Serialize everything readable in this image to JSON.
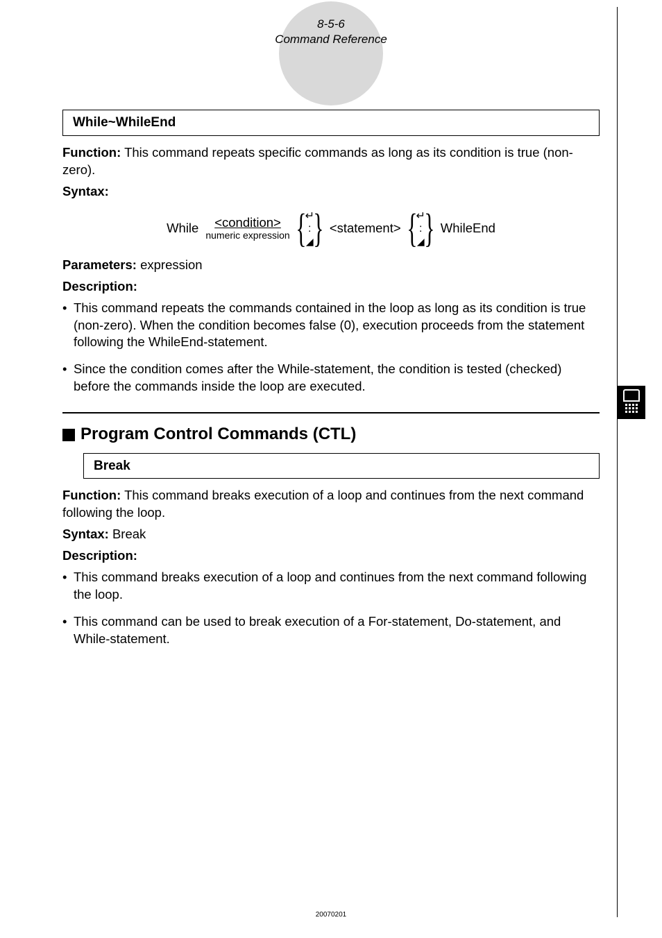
{
  "header": {
    "page_num": "8-5-6",
    "title": "Command Reference"
  },
  "while": {
    "name": "While~WhileEnd",
    "function_label": "Function:",
    "function_text": " This command repeats specific commands as long as its condition is true (non-zero).",
    "syntax_label": "Syntax:",
    "diagram": {
      "while": "While",
      "condition": "<condition>",
      "numeric": "numeric expression",
      "statement": "<statement>",
      "whileend": "WhileEnd",
      "return": "↵",
      "colon": ":",
      "tri": "◢"
    },
    "params_label": "Parameters:",
    "params_text": " expression",
    "desc_label": "Description:",
    "bullets": [
      "This command repeats the commands contained in the loop as long as its condition is true (non-zero). When the condition becomes false (0), execution proceeds from the statement following the WhileEnd-statement.",
      "Since the condition comes after the While-statement, the condition is tested (checked) before the commands inside the loop are executed."
    ]
  },
  "ctl": {
    "section_title": "Program Control Commands (CTL)",
    "break": {
      "name": "Break",
      "function_label": "Function:",
      "function_text": " This command breaks execution of a loop and continues from the next command following the loop.",
      "syntax_label": "Syntax:",
      "syntax_text": " Break",
      "desc_label": "Description:",
      "bullets": [
        "This command breaks execution of a loop and continues from the next command following the loop.",
        "This command can be used to break execution of a For-statement, Do-statement, and While-statement."
      ]
    }
  },
  "footer": "20070201"
}
